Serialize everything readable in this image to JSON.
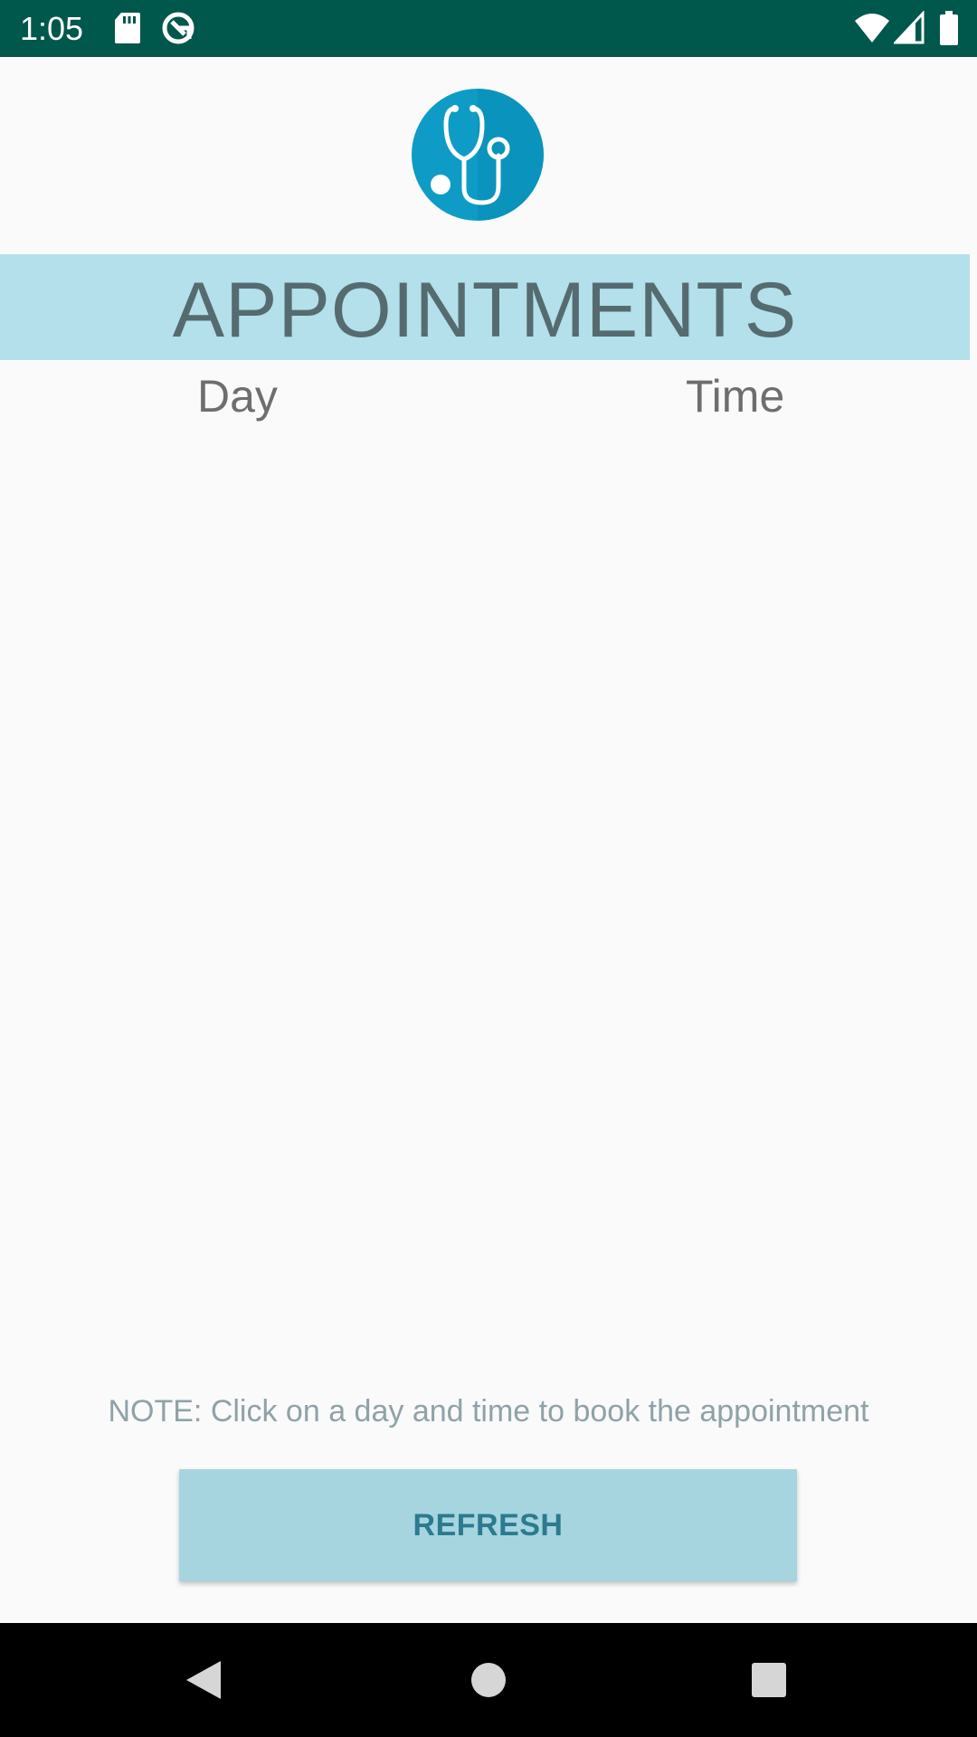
{
  "status_bar": {
    "time": "1:05",
    "icons": [
      "sd-card-icon",
      "sync-icon",
      "wifi-icon",
      "cellular-signal-icon",
      "battery-icon"
    ],
    "background": "#00574b"
  },
  "header": {
    "logo_icon": "stethoscope-icon",
    "logo_color": "#0e9cc6",
    "title": "APPOINTMENTS",
    "title_background": "#b3e0ea"
  },
  "table": {
    "columns": [
      "Day",
      "Time"
    ],
    "rows": []
  },
  "footer": {
    "note": "NOTE: Click on a day and time to book the appointment",
    "refresh_label": "REFRESH",
    "button_color": "#a6d5e0"
  },
  "nav_bar": {
    "buttons": [
      "back-icon",
      "home-icon",
      "recents-icon"
    ]
  }
}
